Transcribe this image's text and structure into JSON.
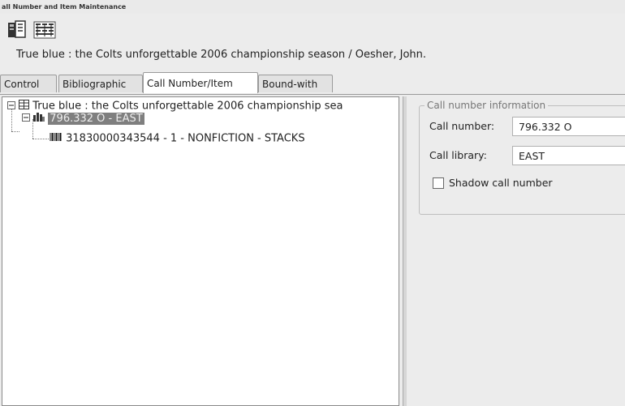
{
  "window": {
    "title": "all Number and Item Maintenance"
  },
  "toolbar": {
    "buttons": [
      {
        "icon": "records-icon"
      },
      {
        "icon": "barcode-grid-icon"
      }
    ]
  },
  "record": {
    "title": "True blue : the Colts unforgettable 2006 championship season / Oesher, John."
  },
  "tabs": [
    "Control",
    "Bibliographic",
    "Call Number/Item",
    "Bound-with"
  ],
  "active_tab": "Call Number/Item",
  "tree": {
    "root": "True blue : the Colts unforgettable 2006 championship sea",
    "call_number": "796.332 O - EAST",
    "item": "31830000343544 - 1 - NONFICTION - STACKS"
  },
  "call_number_info": {
    "legend": "Call number information",
    "call_number_label": "Call number:",
    "call_number_value": "796.332 O",
    "call_library_label": "Call library:",
    "call_library_value": "EAST",
    "shadow_label": "Shadow call number",
    "shadow_checked": false
  }
}
